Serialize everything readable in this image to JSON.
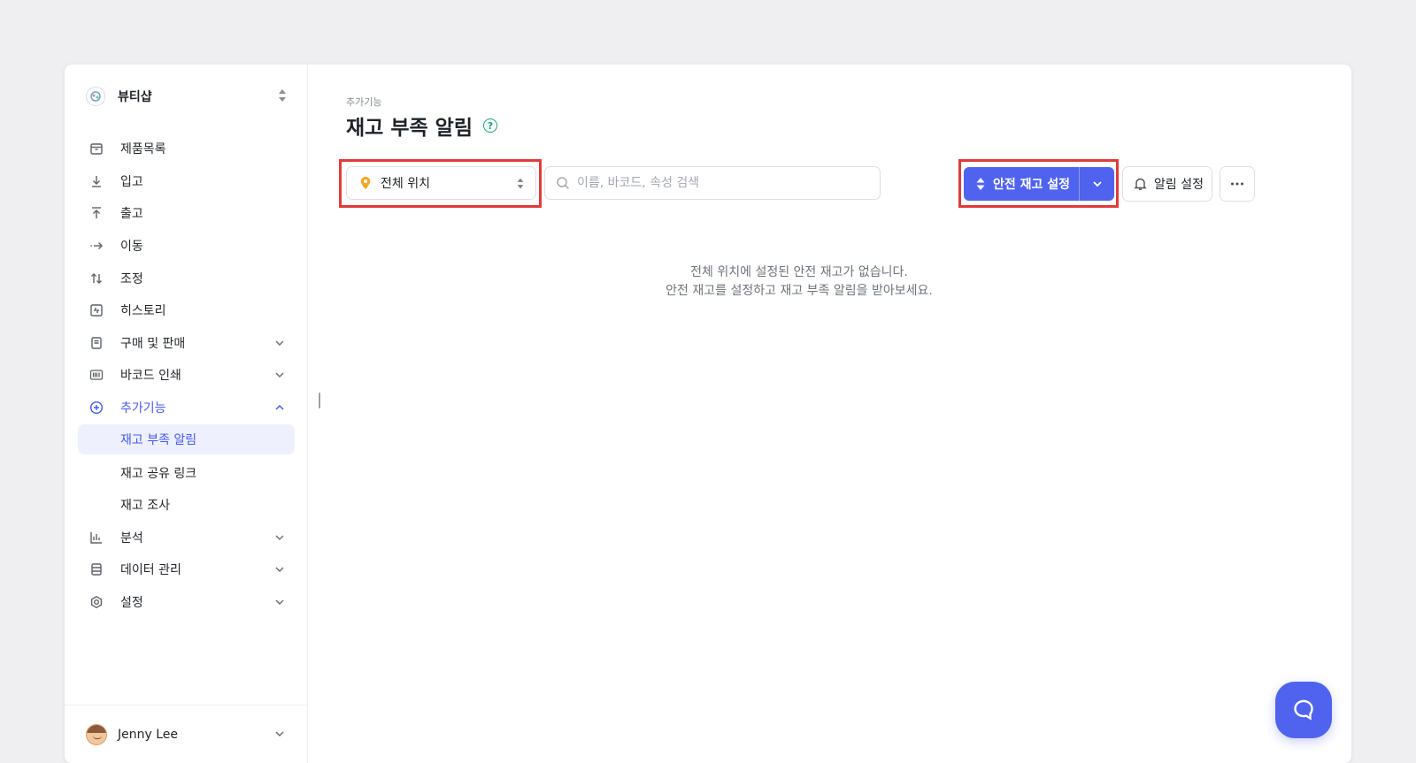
{
  "sidebar": {
    "shop_name": "뷰티샵",
    "items": [
      {
        "label": "제품목록",
        "icon": "box-icon"
      },
      {
        "label": "입고",
        "icon": "arrow-down-icon"
      },
      {
        "label": "출고",
        "icon": "arrow-up-icon"
      },
      {
        "label": "이동",
        "icon": "arrow-right-dotted-icon"
      },
      {
        "label": "조정",
        "icon": "swap-vertical-icon"
      },
      {
        "label": "히스토리",
        "icon": "history-icon"
      },
      {
        "label": "구매 및 판매",
        "icon": "document-icon"
      },
      {
        "label": "바코드 인쇄",
        "icon": "barcode-icon"
      },
      {
        "label": "추가기능",
        "icon": "plus-circle-icon"
      },
      {
        "label": "분석",
        "icon": "bar-chart-icon"
      },
      {
        "label": "데이터 관리",
        "icon": "database-icon"
      },
      {
        "label": "설정",
        "icon": "gear-icon"
      }
    ],
    "sub_items": [
      {
        "label": "재고 부족 알림"
      },
      {
        "label": "재고 공유 링크"
      },
      {
        "label": "재고 조사"
      }
    ],
    "user_name": "Jenny Lee"
  },
  "main": {
    "breadcrumb": "추가기능",
    "title": "재고 부족 알림",
    "location_select": "전체 위치",
    "search_placeholder": "이름, 바코드, 속성 검색",
    "safety_stock_button": "안전 재고 설정",
    "alarm_settings_button": "알림 설정",
    "empty_line1": "전체 위치에 설정된 안전 재고가 없습니다.",
    "empty_line2": "안전 재고를 설정하고 재고 부족 알림을 받아보세요."
  },
  "colors": {
    "accent": "#4f63ee",
    "active_text": "#4759f0",
    "highlight_box": "#e03a3a",
    "help_icon": "#1e9e74",
    "pin": "#f5a623"
  }
}
